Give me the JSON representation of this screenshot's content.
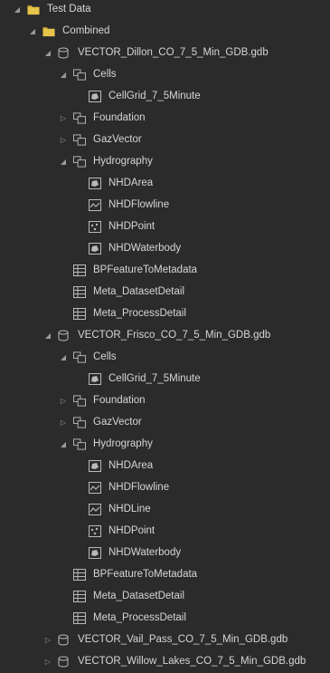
{
  "colors": {
    "background": "#2b2b2b",
    "text": "#d6d6d6",
    "folder": "#e8c44a",
    "icon": "#b9b9b9"
  },
  "tree": [
    {
      "label": "Test Data",
      "level": 0,
      "icon": "folder-icon",
      "expanded": true
    },
    {
      "label": "Combined",
      "level": 1,
      "icon": "folder-icon",
      "expanded": true
    },
    {
      "label": "VECTOR_Dillon_CO_7_5_Min_GDB.gdb",
      "level": 2,
      "icon": "geodatabase-icon",
      "expanded": true
    },
    {
      "label": "Cells",
      "level": 3,
      "icon": "feature-dataset-icon",
      "expanded": true
    },
    {
      "label": "CellGrid_7_5Minute",
      "level": 4,
      "icon": "polygon-feature-class-icon"
    },
    {
      "label": "Foundation",
      "level": 3,
      "icon": "feature-dataset-icon",
      "expanded": false
    },
    {
      "label": "GazVector",
      "level": 3,
      "icon": "feature-dataset-icon",
      "expanded": false
    },
    {
      "label": "Hydrography",
      "level": 3,
      "icon": "feature-dataset-icon",
      "expanded": true
    },
    {
      "label": "NHDArea",
      "level": 4,
      "icon": "polygon-feature-class-icon"
    },
    {
      "label": "NHDFlowline",
      "level": 4,
      "icon": "line-feature-class-icon"
    },
    {
      "label": "NHDPoint",
      "level": 4,
      "icon": "point-feature-class-icon"
    },
    {
      "label": "NHDWaterbody",
      "level": 4,
      "icon": "polygon-feature-class-icon"
    },
    {
      "label": "BPFeatureToMetadata",
      "level": 3,
      "icon": "table-icon"
    },
    {
      "label": "Meta_DatasetDetail",
      "level": 3,
      "icon": "table-icon"
    },
    {
      "label": "Meta_ProcessDetail",
      "level": 3,
      "icon": "table-icon"
    },
    {
      "label": "VECTOR_Frisco_CO_7_5_Min_GDB.gdb",
      "level": 2,
      "icon": "geodatabase-icon",
      "expanded": true
    },
    {
      "label": "Cells",
      "level": 3,
      "icon": "feature-dataset-icon",
      "expanded": true
    },
    {
      "label": "CellGrid_7_5Minute",
      "level": 4,
      "icon": "polygon-feature-class-icon"
    },
    {
      "label": "Foundation",
      "level": 3,
      "icon": "feature-dataset-icon",
      "expanded": false
    },
    {
      "label": "GazVector",
      "level": 3,
      "icon": "feature-dataset-icon",
      "expanded": false
    },
    {
      "label": "Hydrography",
      "level": 3,
      "icon": "feature-dataset-icon",
      "expanded": true
    },
    {
      "label": "NHDArea",
      "level": 4,
      "icon": "polygon-feature-class-icon"
    },
    {
      "label": "NHDFlowline",
      "level": 4,
      "icon": "line-feature-class-icon"
    },
    {
      "label": "NHDLine",
      "level": 4,
      "icon": "line-feature-class-icon"
    },
    {
      "label": "NHDPoint",
      "level": 4,
      "icon": "point-feature-class-icon"
    },
    {
      "label": "NHDWaterbody",
      "level": 4,
      "icon": "polygon-feature-class-icon"
    },
    {
      "label": "BPFeatureToMetadata",
      "level": 3,
      "icon": "table-icon"
    },
    {
      "label": "Meta_DatasetDetail",
      "level": 3,
      "icon": "table-icon"
    },
    {
      "label": "Meta_ProcessDetail",
      "level": 3,
      "icon": "table-icon"
    },
    {
      "label": "VECTOR_Vail_Pass_CO_7_5_Min_GDB.gdb",
      "level": 2,
      "icon": "geodatabase-icon",
      "expanded": false
    },
    {
      "label": "VECTOR_Willow_Lakes_CO_7_5_Min_GDB.gdb",
      "level": 2,
      "icon": "geodatabase-icon",
      "expanded": false
    }
  ]
}
